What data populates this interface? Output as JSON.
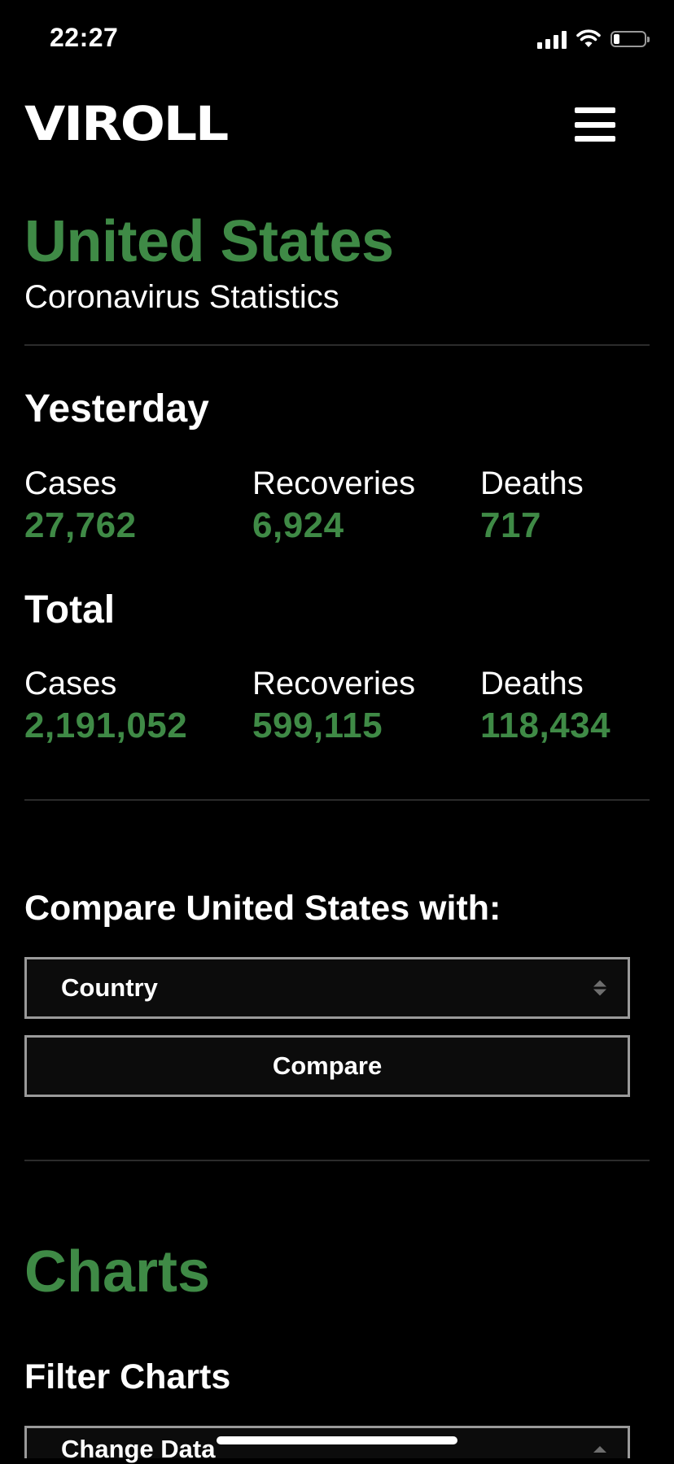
{
  "status_bar": {
    "time": "22:27",
    "battery_level": 0.2,
    "icons": [
      "signal-icon",
      "wifi-icon",
      "battery-icon"
    ]
  },
  "header": {
    "logo": "VIROLL",
    "menu_icon": "hamburger-menu-icon"
  },
  "country": {
    "name": "United States",
    "subtitle": "Coronavirus Statistics"
  },
  "yesterday": {
    "heading": "Yesterday",
    "stats": [
      {
        "label": "Cases",
        "value": "27,762"
      },
      {
        "label": "Recoveries",
        "value": "6,924"
      },
      {
        "label": "Deaths",
        "value": "717"
      }
    ]
  },
  "total": {
    "heading": "Total",
    "stats": [
      {
        "label": "Cases",
        "value": "2,191,052"
      },
      {
        "label": "Recoveries",
        "value": "599,115"
      },
      {
        "label": "Deaths",
        "value": "118,434"
      }
    ]
  },
  "compare": {
    "heading": "Compare United States with:",
    "select_value": "Country",
    "button_label": "Compare"
  },
  "charts": {
    "title": "Charts",
    "filter_heading": "Filter Charts",
    "filter_select_value": "Change Data"
  },
  "colors": {
    "accent_green": "#3f8a46",
    "background": "#000000",
    "border_gray": "#9a9a9a"
  }
}
